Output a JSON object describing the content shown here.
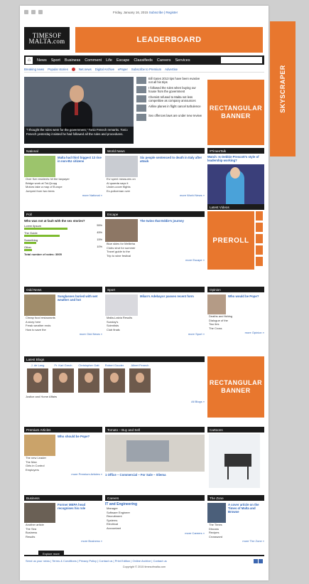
{
  "topbar": {
    "date": "Friday, January 16, 2015",
    "extra": "Subscribe | Register"
  },
  "logo": {
    "line1": "TIMESOF",
    "line2": "MALTA.com"
  },
  "ads": {
    "leader": "LEADERBOARD",
    "sky": "SKYSCRAPER",
    "rect1": "RECTANGULAR BANNER",
    "preroll": "PREROLL",
    "rect2": "RECTANGULAR BANNER"
  },
  "nav": {
    "items": [
      "News",
      "Sport",
      "Business",
      "Comment",
      "Life",
      "Escape",
      "Classifieds",
      "Careers",
      "Services"
    ]
  },
  "subnav": {
    "items": [
      "Breaking news",
      "Popular stories",
      "Net.news",
      "Digital Archive",
      "ePaper",
      "Subscribe to Premium",
      "Advertise"
    ]
  },
  "hero": {
    "caption": "\"I thought the rules were for the government,\" Tonio Fenech remarks. Tonio Fenech yesterday insisted he had followed all the rules and procedures."
  },
  "headlines": [
    "Bill Gates 2013 tips have been evasive not all his trips",
    "I followed the rules when buying our house from the government",
    "Chemist refused to Malta not less competitive as company announces",
    "Airline planes in flight cancel turbulence",
    "Sex offences laws are under new review"
  ],
  "sections": {
    "national": {
      "title": "National",
      "lead": "Malta had third biggest 13 rise in non-EU citizens",
      "items": [
        "Over five residents hit the taxpayer",
        "Bridge work at Tal-Qroqq",
        "Motors take a map of Europe",
        "Jumped from two trees"
      ],
      "more": "more National »"
    },
    "world": {
      "title": "World News",
      "lead": "Six people sentenced to death in Italy after attack",
      "items": [
        "EU spent measures on",
        "Al quaeda says it",
        "Under-cover flights",
        "Ex-policeman over"
      ],
      "more": "more World News »"
    },
    "tv": {
      "title": "#TimesTalk",
      "lead": "Watch: Is Debbie Prescott's style of leadership working?"
    },
    "poll": {
      "title": "Poll",
      "question": "Who was not at fault with the sex stories?",
      "options": [
        {
          "label": "Lorem lipsum",
          "pct": "55%",
          "fill": 0.55
        },
        {
          "label": "The Guide",
          "pct": "45%",
          "fill": 0.45
        },
        {
          "label": "Something",
          "pct": "15%",
          "fill": 0.15
        },
        {
          "label": "Other",
          "pct": "10%",
          "fill": 0.1
        }
      ],
      "total": "Total number of votes: 3005"
    },
    "escape": {
      "title": "Escape",
      "lead": "The twins that Eddie's journey",
      "items": [
        "Blue skies for Mellieha",
        "Clubs strut for summer",
        "Travel guide to the",
        "Trip to wine festival"
      ],
      "more": "more Escape »"
    },
    "videos": {
      "title": "Latest Videos"
    },
    "odd": {
      "title": "Odd News",
      "lead": "Sunglasses buried with wet weather and hot",
      "items": [
        "Cheap food restaurants",
        "A story here",
        "Freak weather ends",
        "How to save the"
      ],
      "more": "more Odd News »"
    },
    "sport": {
      "title": "Sport",
      "lead": "Milan's Adebayor passes recent form",
      "items": [
        "Malta-Latvia Results",
        "Sunday's",
        "Scientists",
        "Club finals"
      ],
      "more": "more Sport »"
    },
    "opinion": {
      "title": "Opinion",
      "lead": "Who would be Pope?",
      "items": [
        "Deaths and fishing",
        "Dialogue of the",
        "Two lies",
        "The Cross"
      ],
      "more": "more Opinion »"
    },
    "blogs": {
      "title": "Latest Blogs",
      "people": [
        {
          "name": "J. de Lang"
        },
        {
          "name": "Fr. Karl Grech"
        },
        {
          "name": "Christopher Gatt"
        },
        {
          "name": "Robert Gouder"
        },
        {
          "name": "Albert Fenech"
        }
      ],
      "caption": "Justice and Home Affairs",
      "more": "All Blogs »"
    },
    "premium": {
      "title": "Premium Articles",
      "lead": "Who should be Pope?",
      "items": [
        "The new Leader",
        "The Man",
        "Girls in Control",
        "Employers"
      ],
      "more": "more Premium Articles »"
    },
    "tomatoes": {
      "title": "Tomato – Buy and Sell",
      "lead": "1 Office – Commercial – For Sale – Sliema"
    },
    "cartoons": {
      "title": "Cartoons"
    },
    "business": {
      "title": "Business",
      "lead": "Former MEPA head recognises his role",
      "items": [
        "Another article",
        "The Sea",
        "Business",
        "Results"
      ],
      "more": "more Business »"
    },
    "careers": {
      "title": "Careers",
      "lead": "IT and Engineering",
      "items": [
        "Manager",
        "Software Engineer",
        "Recruitment",
        "Systems",
        "Electrical",
        "Accountant"
      ],
      "more": "more Careers »"
    },
    "zone": {
      "title": "The Zone",
      "lead": "A cover article on the Times of Malta and Browse",
      "items": [
        "The Times",
        "Discuss",
        "Recipes",
        "Crossword"
      ],
      "more": "more The Zone »"
    }
  },
  "footer": {
    "tab": "Explore more",
    "links": "Send us your news | Terms & Conditions | Privacy Policy | Contact us | Print Edition | Online Archive | Contact us",
    "copy": "Copyright © 2015 timesofmalta.com"
  }
}
